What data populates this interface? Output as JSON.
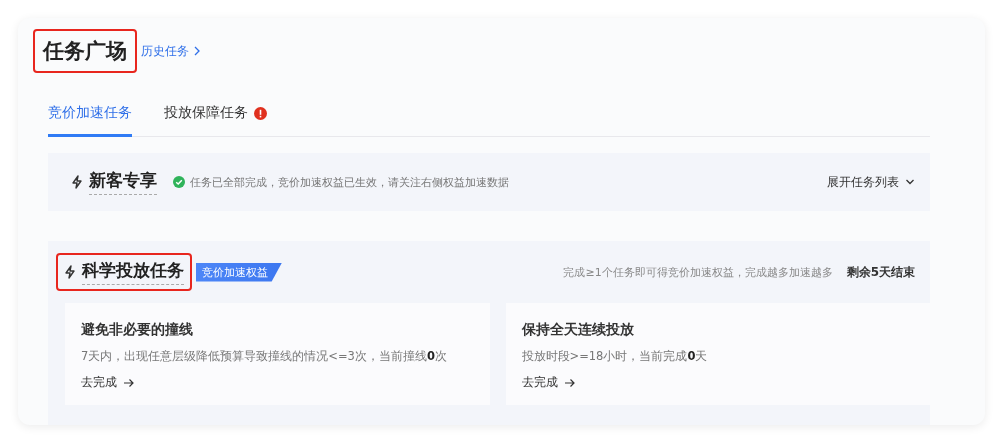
{
  "header": {
    "title": "任务广场",
    "highlighted": true,
    "history_link": "历史任务"
  },
  "tabs": [
    {
      "label": "竞价加速任务",
      "selected": true,
      "alert": false
    },
    {
      "label": "投放保障任务",
      "selected": false,
      "alert": true
    }
  ],
  "sections": [
    {
      "title": "新客专享",
      "highlighted": false,
      "done": true,
      "status": "任务已全部完成，竞价加速权益已生效，请关注右侧权益加速数据",
      "expand_link": "展开任务列表"
    },
    {
      "title": "科学投放任务",
      "highlighted": true,
      "badge": "竞价加速权益",
      "hint": "完成≥1个任务即可得竞价加速权益，完成越多加速越多",
      "remaining": "剩余5天结束",
      "tasks": [
        {
          "title": "避免非必要的撞线",
          "desc": "7天内，出现任意层级降低预算导致撞线的情况<=3次，当前撞线**0**次",
          "action": "去完成"
        },
        {
          "title": "保持全天连续投放",
          "desc": "投放时段>=18小时，当前完成**0**天",
          "action": "去完成"
        }
      ]
    }
  ]
}
